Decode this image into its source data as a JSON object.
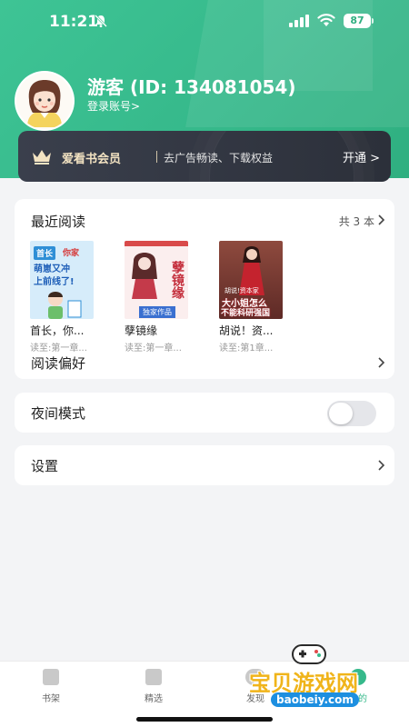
{
  "status_bar": {
    "time": "11:21",
    "battery": "87"
  },
  "profile": {
    "username": "游客 (ID: 134081054)",
    "login_link": "登录账号>"
  },
  "vip": {
    "title": "爱看书会员",
    "description": "去广告畅读、下载权益",
    "action": "开通 >"
  },
  "recent": {
    "title": "最近阅读",
    "count": "共 3 本",
    "books": [
      {
        "title": "首长，你...",
        "progress": "读至:第一章...",
        "cover_text": [
          "首长",
          "你家",
          "萌崽又冲",
          "上前线了!"
        ],
        "cover_color": "#cfe6f7"
      },
      {
        "title": "孽镜缘",
        "progress": "读至:第一章...",
        "cover_text": [
          "孽镜缘",
          "独家作品"
        ],
        "cover_color": "#f7e5e5"
      },
      {
        "title": "胡说！资...",
        "progress": "读至:第1章...",
        "cover_text": [
          "胡说!资本家",
          "大小姐怎么",
          "不能科研强国"
        ],
        "cover_color": "#7a3d33"
      }
    ]
  },
  "menu": {
    "reading_pref": "阅读偏好",
    "night_mode": "夜间模式",
    "night_mode_on": false,
    "settings": "设置"
  },
  "bottom_nav": [
    {
      "label": "书架",
      "icon": "bookshelf-icon"
    },
    {
      "label": "精选",
      "icon": "featured-icon"
    },
    {
      "label": "发现",
      "icon": "discover-icon"
    },
    {
      "label": "我的",
      "icon": "profile-icon"
    }
  ],
  "watermark": {
    "text": "宝贝游戏网",
    "url": "baobeiy.com"
  },
  "colors": {
    "accent_green": "#36b98b",
    "vip_gold": "#f3e3c2",
    "vip_bg": "#2c303a"
  }
}
